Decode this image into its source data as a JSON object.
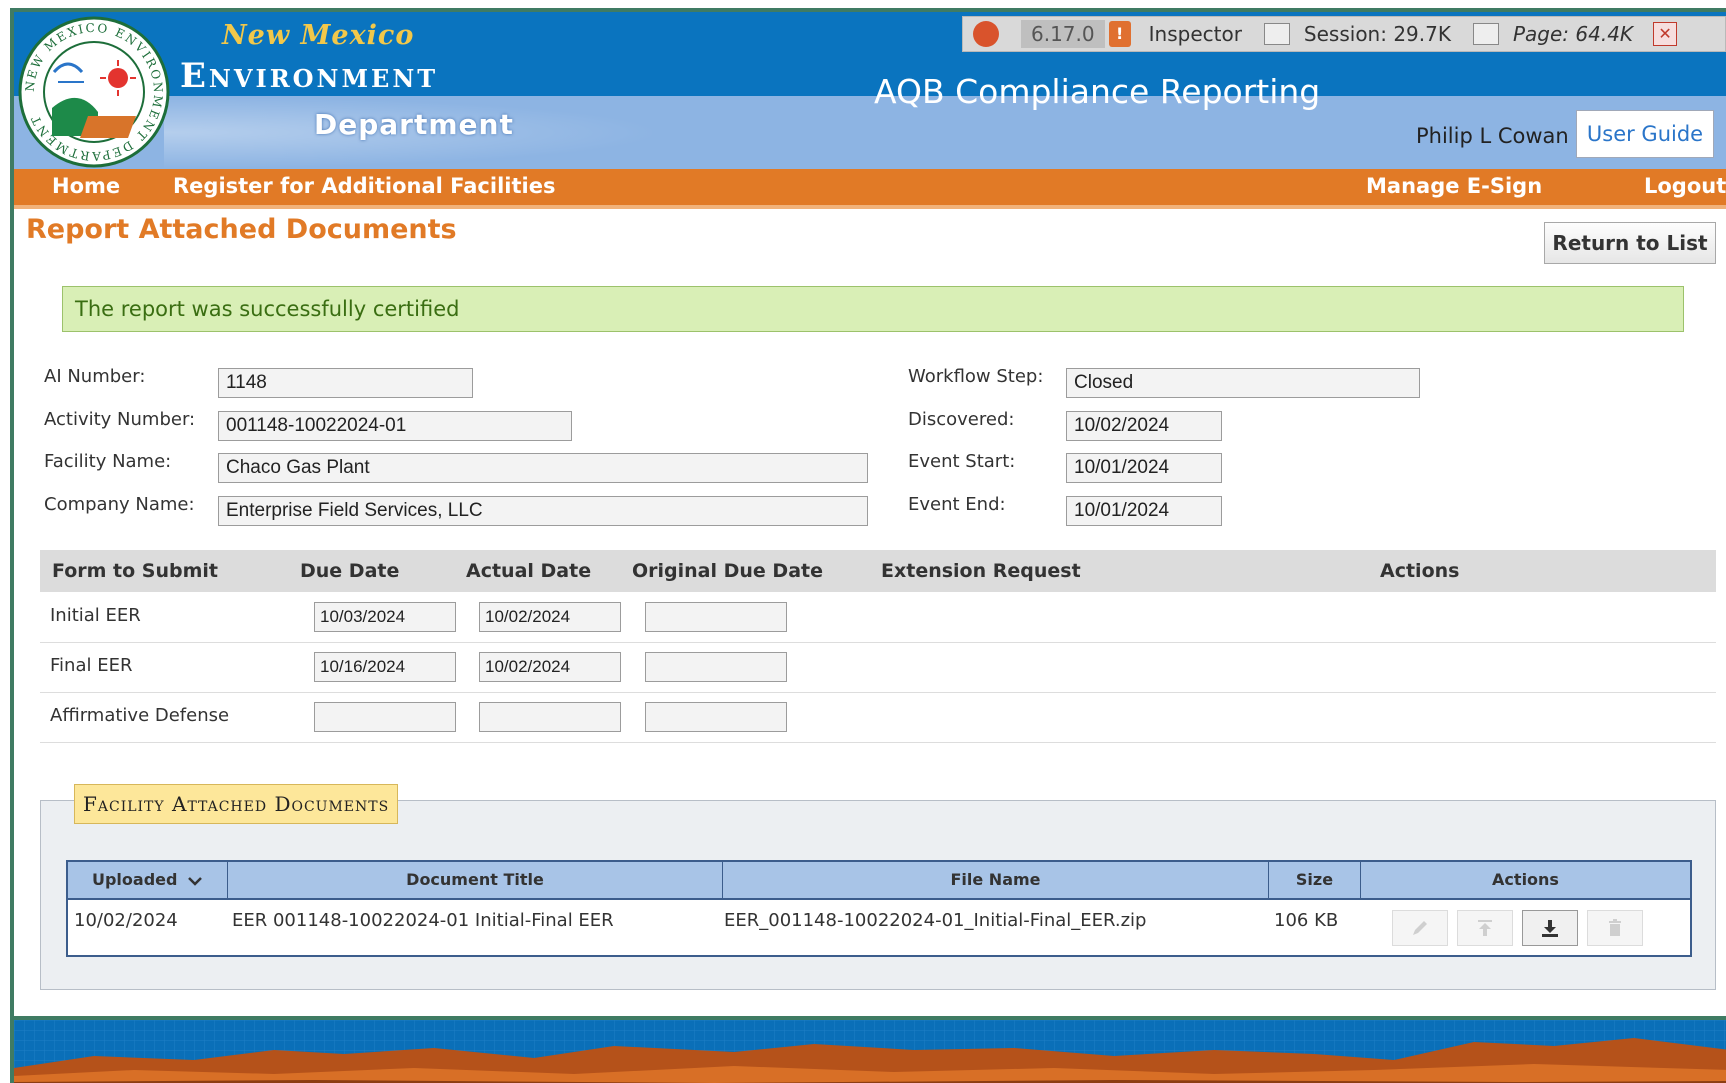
{
  "brand": {
    "logo_ring_text": "NEW MEXICO ENVIRONMENT DEPARTMENT",
    "line1": "New Mexico",
    "line2": "Environment",
    "line3": "Department"
  },
  "app_title": "AQB Compliance Reporting",
  "inspector": {
    "version": "6.17.0",
    "label": "Inspector",
    "session": "Session: 29.7K",
    "page": "Page: 64.4K"
  },
  "user": {
    "name": "Philip L Cowan",
    "guide_label": "User Guide"
  },
  "nav": {
    "left": [
      "Home",
      "Register for Additional Facilities"
    ],
    "right": [
      "Manage E-Sign",
      "Logout"
    ]
  },
  "page": {
    "title": "Report Attached Documents",
    "return_label": "Return to List",
    "success_message": "The report was successfully certified"
  },
  "fields": {
    "ai_number": {
      "label": "AI Number:",
      "value": "1148"
    },
    "activity_number": {
      "label": "Activity Number:",
      "value": "001148-10022024-01"
    },
    "facility_name": {
      "label": "Facility Name:",
      "value": "Chaco Gas Plant"
    },
    "company_name": {
      "label": "Company Name:",
      "value": "Enterprise Field Services, LLC"
    },
    "workflow_step": {
      "label": "Workflow Step:",
      "value": "Closed"
    },
    "discovered": {
      "label": "Discovered:",
      "value": "10/02/2024"
    },
    "event_start": {
      "label": "Event Start:",
      "value": "10/01/2024"
    },
    "event_end": {
      "label": "Event End:",
      "value": "10/01/2024"
    }
  },
  "forms_table": {
    "headers": [
      "Form to Submit",
      "Due Date",
      "Actual Date",
      "Original Due Date",
      "Extension Request",
      "Actions"
    ],
    "rows": [
      {
        "form": "Initial EER",
        "due": "10/03/2024",
        "actual": "10/02/2024",
        "original": ""
      },
      {
        "form": "Final EER",
        "due": "10/16/2024",
        "actual": "10/02/2024",
        "original": ""
      },
      {
        "form": "Affirmative Defense",
        "due": "",
        "actual": "",
        "original": ""
      }
    ]
  },
  "documents": {
    "legend": "Facility Attached Documents",
    "headers": [
      "Uploaded",
      "Document Title",
      "File Name",
      "Size",
      "Actions"
    ],
    "rows": [
      {
        "uploaded": "10/02/2024",
        "title": "EER 001148-10022024-01 Initial-Final EER",
        "file_name": "EER_001148-10022024-01_Initial-Final_EER.zip",
        "size": "106 KB",
        "actions": [
          "edit-icon",
          "upload-icon",
          "download-icon",
          "trash-icon"
        ]
      }
    ]
  },
  "colors": {
    "header_blue": "#0a74bf",
    "header_light": "#8db4e3",
    "nav_orange": "#e17a26",
    "success_bg": "#d9efb6",
    "legend_bg": "#fde79a",
    "table_head": "#a8c4e7"
  }
}
